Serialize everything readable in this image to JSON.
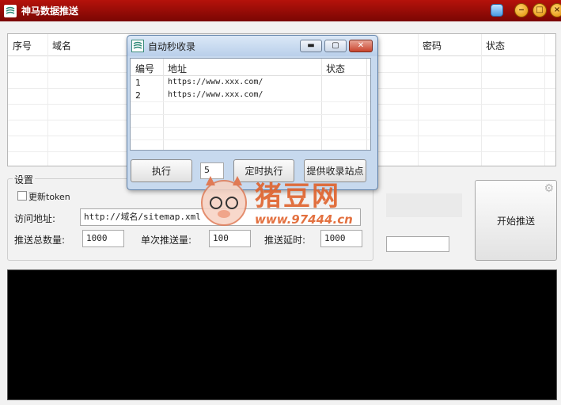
{
  "window": {
    "title": "神马数据推送"
  },
  "main_table": {
    "columns": [
      "序号",
      "域名",
      "密码",
      "状态"
    ]
  },
  "settings": {
    "legend": "设置",
    "update_token_label": "更新token",
    "visit_url_label": "访问地址:",
    "visit_url_value": "http://域名/sitemap.xml",
    "total_push_label": "推送总数量:",
    "total_push_value": "1000",
    "single_push_label": "单次推送量:",
    "single_push_value": "100",
    "push_delay_label": "推送延时:",
    "push_delay_value": "1000"
  },
  "start_button": {
    "label": "开始推送"
  },
  "dialog": {
    "title": "自动秒收录",
    "columns": [
      "编号",
      "地址",
      "状态"
    ],
    "rows": [
      {
        "id": "1",
        "url": "https://www.xxx.com/",
        "status": ""
      },
      {
        "id": "2",
        "url": "https://www.xxx.com/",
        "status": ""
      }
    ],
    "execute_label": "执行",
    "interval_value": "5",
    "scheduled_label": "定时执行",
    "provide_sites_label": "提供收录站点"
  },
  "watermark": {
    "brand": "猪豆网",
    "url": "www.97444.cn"
  },
  "colors": {
    "titlebar": "#9e0e08",
    "console": "#000000",
    "dialog_frame": "#c7d9ee"
  }
}
